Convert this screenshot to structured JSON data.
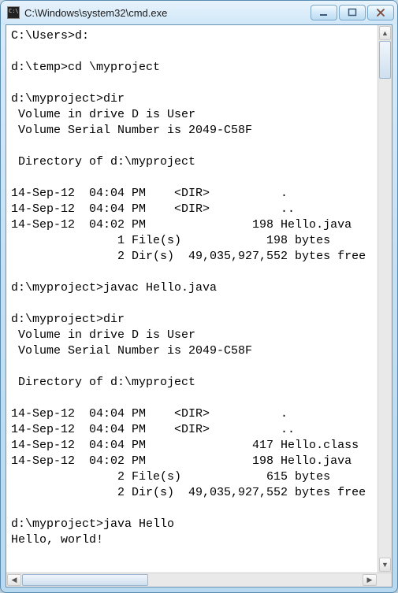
{
  "window": {
    "title": "C:\\Windows\\system32\\cmd.exe"
  },
  "console": {
    "lines": [
      "C:\\Users>d:",
      "",
      "d:\\temp>cd \\myproject",
      "",
      "d:\\myproject>dir",
      " Volume in drive D is User",
      " Volume Serial Number is 2049-C58F",
      "",
      " Directory of d:\\myproject",
      "",
      "14-Sep-12  04:04 PM    <DIR>          .",
      "14-Sep-12  04:04 PM    <DIR>          ..",
      "14-Sep-12  04:02 PM               198 Hello.java",
      "               1 File(s)            198 bytes",
      "               2 Dir(s)  49,035,927,552 bytes free",
      "",
      "d:\\myproject>javac Hello.java",
      "",
      "d:\\myproject>dir",
      " Volume in drive D is User",
      " Volume Serial Number is 2049-C58F",
      "",
      " Directory of d:\\myproject",
      "",
      "14-Sep-12  04:04 PM    <DIR>          .",
      "14-Sep-12  04:04 PM    <DIR>          ..",
      "14-Sep-12  04:04 PM               417 Hello.class",
      "14-Sep-12  04:02 PM               198 Hello.java",
      "               2 File(s)            615 bytes",
      "               2 Dir(s)  49,035,927,552 bytes free",
      "",
      "d:\\myproject>java Hello",
      "Hello, world!",
      ""
    ]
  }
}
